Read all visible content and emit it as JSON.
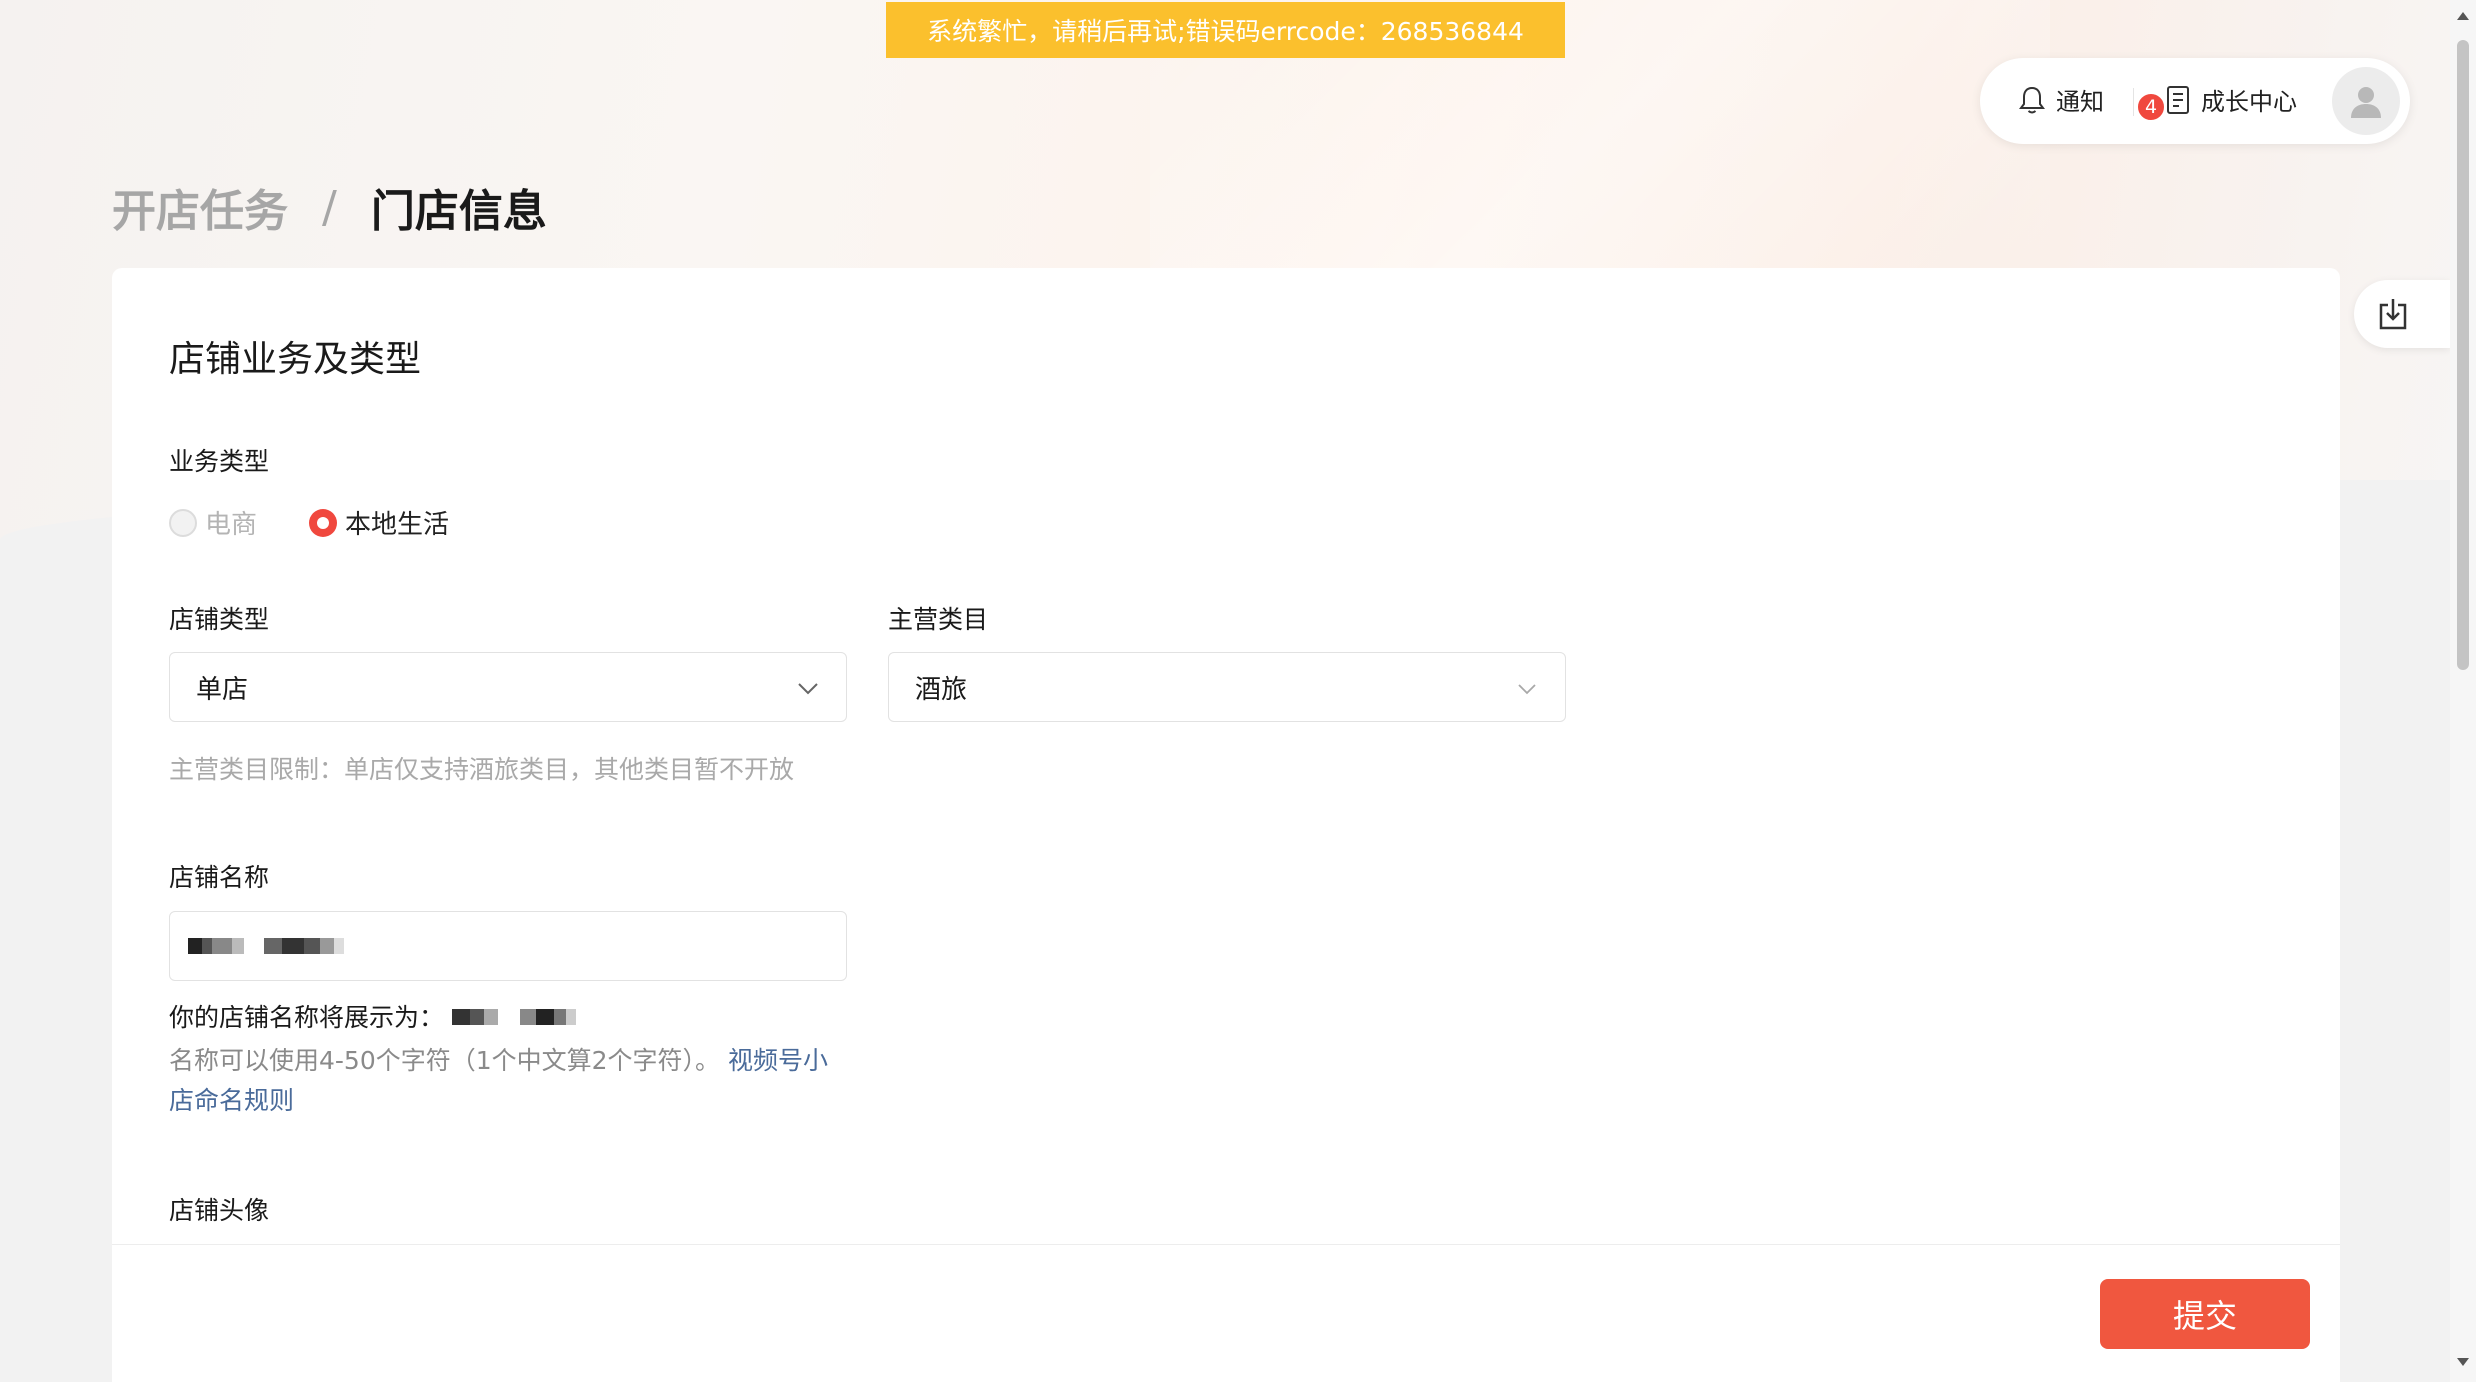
{
  "banner": {
    "text": "系统繁忙，请稍后再试;错误码errcode：268536844"
  },
  "header": {
    "notify_label": "通知",
    "notify_count": "4",
    "growth_label": "成长中心"
  },
  "breadcrumb": {
    "parent": "开店任务",
    "separator": "/",
    "current": "门店信息"
  },
  "section": {
    "title": "店铺业务及类型"
  },
  "business_type": {
    "label": "业务类型",
    "options": [
      "电商",
      "本地生活"
    ],
    "selected": "本地生活"
  },
  "shop_type": {
    "label": "店铺类型",
    "value": "单店"
  },
  "main_category": {
    "label": "主营类目",
    "value": "酒旅"
  },
  "category_hint": "主营类目限制：单店仅支持酒旅类目，其他类目暂不开放",
  "shop_name": {
    "label": "店铺名称",
    "preview_label": "你的店铺名称将展示为：",
    "rule_text": "名称可以使用4-50个字符（1个中文算2个字符）。",
    "rule_link": "视频号小店命名规则"
  },
  "avatar_section": {
    "label": "店铺头像"
  },
  "footer": {
    "submit_label": "提交"
  },
  "colors": {
    "accent": "#f0573f",
    "banner": "#fbc02d",
    "link": "#4a6b9a"
  }
}
